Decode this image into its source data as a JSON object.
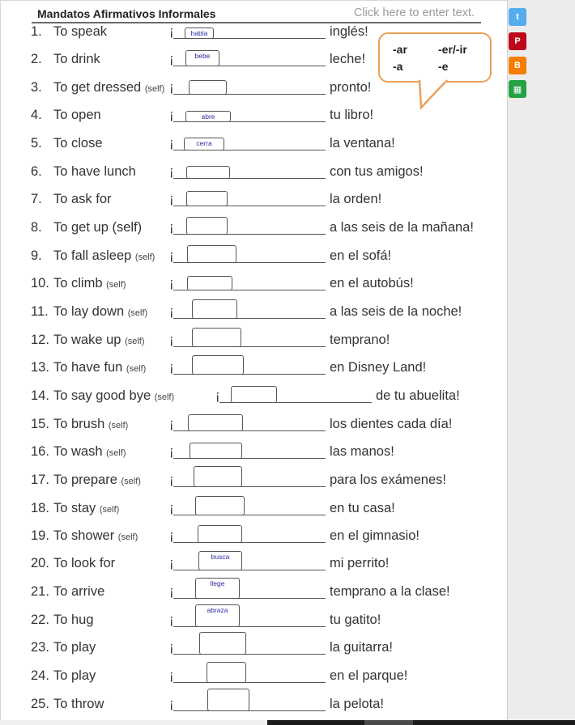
{
  "header": {
    "title": "Mandatos Afirmativos Informales",
    "placeholder": "Click here to enter text."
  },
  "bubble": {
    "col1_top": "-ar",
    "col1_bottom": "-a",
    "col2_top": "-er/-ir",
    "col2_bottom": "-e"
  },
  "exclamation": "¡",
  "items": [
    {
      "num": "1.",
      "english": "To speak",
      "self": "",
      "answer": "habla",
      "rest": "inglés!"
    },
    {
      "num": "2.",
      "english": "To drink",
      "self": "",
      "answer": "bebe",
      "rest": "leche!"
    },
    {
      "num": "3.",
      "english": "To get dressed",
      "self": "(self)",
      "answer": "",
      "rest": "pronto!"
    },
    {
      "num": "4.",
      "english": "To open",
      "self": "",
      "answer": "abre",
      "rest": "tu libro!"
    },
    {
      "num": "5.",
      "english": "To close",
      "self": "",
      "answer": "cerra",
      "rest": "la ventana!"
    },
    {
      "num": "6.",
      "english": "To have lunch",
      "self": "",
      "answer": "",
      "rest": "con tus amigos!"
    },
    {
      "num": "7.",
      "english": "To ask for",
      "self": "",
      "answer": "",
      "rest": "la orden!"
    },
    {
      "num": "8.",
      "english": "To get up (self)",
      "self": "",
      "answer": "",
      "rest": "a las seis de la mañana!"
    },
    {
      "num": "9.",
      "english": "To fall asleep",
      "self": "(self)",
      "answer": "",
      "rest": "en el sofá!"
    },
    {
      "num": "10.",
      "english": "To climb",
      "self": "(self)",
      "answer": "",
      "rest": "en el autobús!"
    },
    {
      "num": "11.",
      "english": "To lay down",
      "self": "(self)",
      "answer": "",
      "rest": "a las seis de la noche!"
    },
    {
      "num": "12.",
      "english": "To wake up",
      "self": "(self)",
      "answer": "",
      "rest": "temprano!"
    },
    {
      "num": "13.",
      "english": "To have fun",
      "self": "(self)",
      "answer": "",
      "rest": "en Disney Land!"
    },
    {
      "num": "14.",
      "english": "To say good bye",
      "self": "(self)",
      "answer": "",
      "rest": "de tu abuelita!"
    },
    {
      "num": "15.",
      "english": "To brush",
      "self": "(self)",
      "answer": "",
      "rest": "los dientes cada día!"
    },
    {
      "num": "16.",
      "english": "To wash",
      "self": "(self)",
      "answer": "",
      "rest": "las manos!"
    },
    {
      "num": "17.",
      "english": "To prepare",
      "self": "(self)",
      "answer": "",
      "rest": "para los exámenes!"
    },
    {
      "num": "18.",
      "english": "To stay",
      "self": "(self)",
      "answer": "",
      "rest": "en tu casa!"
    },
    {
      "num": "19.",
      "english": "To shower",
      "self": "(self)",
      "answer": "",
      "rest": "en el gimnasio!"
    },
    {
      "num": "20.",
      "english": "To look for",
      "self": "",
      "answer": "busca",
      "rest": "mi perrito!"
    },
    {
      "num": "21.",
      "english": "To arrive",
      "self": "",
      "answer": "llege",
      "rest": "temprano a la clase!"
    },
    {
      "num": "22.",
      "english": "To hug",
      "self": "",
      "answer": "abraza",
      "rest": "tu gatito!"
    },
    {
      "num": "23.",
      "english": "To play",
      "self": "",
      "answer": "",
      "rest": "la guitarra!"
    },
    {
      "num": "24.",
      "english": "To play",
      "self": "",
      "answer": "",
      "rest": "en el parque!"
    },
    {
      "num": "25.",
      "english": "To throw",
      "self": "",
      "answer": "",
      "rest": "la pelota!"
    }
  ],
  "social": [
    {
      "name": "twitter",
      "glyph": "t",
      "color": "#55acee"
    },
    {
      "name": "pinterest",
      "glyph": "P",
      "color": "#bd081c"
    },
    {
      "name": "blogger",
      "glyph": "B",
      "color": "#f57d00"
    },
    {
      "name": "classroom",
      "glyph": "▦",
      "color": "#25a244"
    }
  ]
}
